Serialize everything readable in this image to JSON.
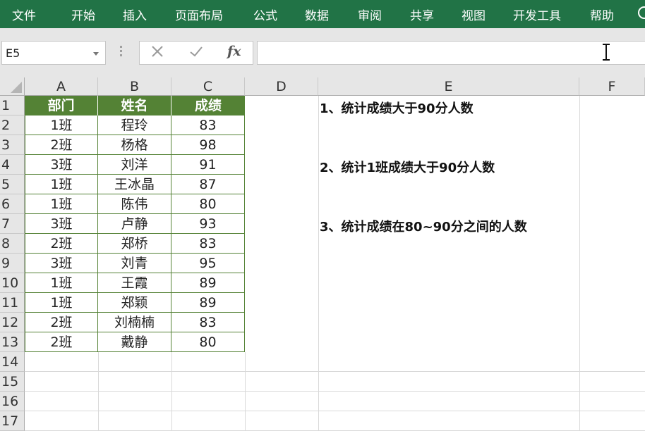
{
  "ribbon": {
    "tabs": [
      "文件",
      "开始",
      "插入",
      "页面布局",
      "公式",
      "数据",
      "审阅",
      "共享",
      "视图",
      "开发工具",
      "帮助"
    ]
  },
  "formula_bar": {
    "name_box": "E5",
    "cancel_icon": "cancel-x-icon",
    "enter_icon": "checkmark-icon",
    "fx_label": "fx",
    "formula_value": ""
  },
  "grid": {
    "columns": [
      "A",
      "B",
      "C",
      "D",
      "E",
      "F"
    ],
    "rows": [
      "1",
      "2",
      "3",
      "4",
      "5",
      "6",
      "7",
      "8",
      "9",
      "10",
      "11",
      "12",
      "13",
      "14",
      "15",
      "16",
      "17"
    ]
  },
  "table": {
    "headers": [
      "部门",
      "姓名",
      "成绩"
    ],
    "rows": [
      [
        "1班",
        "程玲",
        "83"
      ],
      [
        "2班",
        "杨格",
        "98"
      ],
      [
        "3班",
        "刘洋",
        "91"
      ],
      [
        "1班",
        "王冰晶",
        "87"
      ],
      [
        "1班",
        "陈伟",
        "80"
      ],
      [
        "3班",
        "卢静",
        "93"
      ],
      [
        "2班",
        "郑桥",
        "83"
      ],
      [
        "3班",
        "刘青",
        "95"
      ],
      [
        "1班",
        "王霞",
        "89"
      ],
      [
        "1班",
        "郑颖",
        "89"
      ],
      [
        "2班",
        "刘楠楠",
        "83"
      ],
      [
        "2班",
        "戴静",
        "80"
      ]
    ]
  },
  "notes": [
    "1、统计成绩大于90分人数",
    "2、统计1班成绩大于90分人数",
    "3、统计成绩在80~90分之间的人数"
  ],
  "colors": {
    "ribbon": "#217346",
    "table_header": "#548235"
  }
}
